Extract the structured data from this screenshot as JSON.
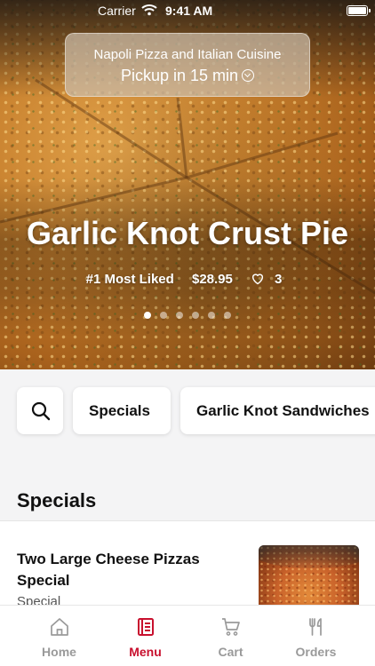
{
  "status_bar": {
    "carrier": "Carrier",
    "time": "9:41 AM"
  },
  "header": {
    "restaurant_name": "Napoli Pizza and Italian Cuisine",
    "pickup_text": "Pickup in 15 min"
  },
  "hero": {
    "title": "Garlic Knot Crust Pie",
    "badge": "#1 Most Liked",
    "price": "$28.95",
    "likes": "3",
    "carousel_active_index": 0,
    "carousel_count": 6
  },
  "categories": {
    "items": [
      "Specials",
      "Garlic Knot Sandwiches"
    ]
  },
  "section": {
    "title": "Specials"
  },
  "menu_items": [
    {
      "title": "Two Large Cheese Pizzas Special",
      "subtitle": "Special"
    }
  ],
  "tabs": [
    {
      "label": "Home",
      "icon": "home-icon",
      "active": false
    },
    {
      "label": "Menu",
      "icon": "menu-icon",
      "active": true
    },
    {
      "label": "Cart",
      "icon": "cart-icon",
      "active": false
    },
    {
      "label": "Orders",
      "icon": "fork-knife-icon",
      "active": false
    }
  ],
  "colors": {
    "accent": "#c8102e",
    "tab_inactive": "#9a9a9a"
  }
}
